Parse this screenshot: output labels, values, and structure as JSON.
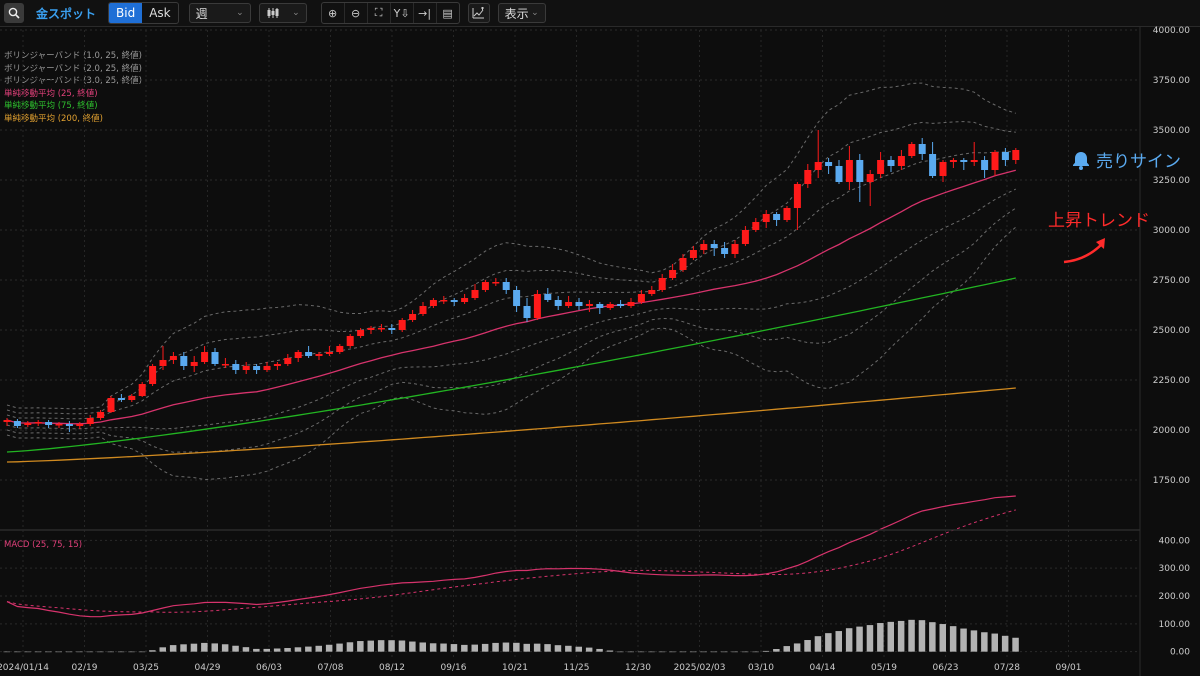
{
  "toolbar": {
    "symbol": "金スポット",
    "bid_label": "Bid",
    "ask_label": "Ask",
    "period": "週",
    "display_label": "表示"
  },
  "legend": [
    {
      "text": "ボリンジャーバンド (1.0, 25, 終値)",
      "color": "#9a9a9a"
    },
    {
      "text": "ボリンジャーバンド (2.0, 25, 終値)",
      "color": "#9a9a9a"
    },
    {
      "text": "ボリンジャーバンド (3.0, 25, 終値)",
      "color": "#9a9a9a"
    },
    {
      "text": "単純移動平均 (25, 終値)",
      "color": "#e0407a"
    },
    {
      "text": "単純移動平均 (75, 終値)",
      "color": "#2ec02e"
    },
    {
      "text": "単純移動平均 (200, 終値)",
      "color": "#e0a030"
    }
  ],
  "macd_label": "MACD (25, 75, 15)",
  "annotations": {
    "sell_sign": "売りサイン",
    "uptrend": "上昇トレンド"
  },
  "colors": {
    "up": "#ff1a1a",
    "down": "#5aaaf0",
    "ma25": "#d6336c",
    "ma75": "#22b422",
    "ma200": "#d08a20",
    "bb": "#6a6a6a",
    "hist": "#b3b3b3"
  },
  "chart_data": {
    "type": "candlestick",
    "price_axis": {
      "min": 1500,
      "max": 4000,
      "ticks": [
        "4000.00",
        "3750.00",
        "3500.00",
        "3250.00",
        "3000.00",
        "2750.00",
        "2500.00",
        "2250.00",
        "2000.00",
        "1750.00"
      ]
    },
    "macd_axis": {
      "min": -30,
      "max": 430,
      "ticks": [
        "400.00",
        "300.00",
        "200.00",
        "100.00",
        "0.00"
      ]
    },
    "date_labels": [
      "2024/01/14",
      "02/19",
      "03/25",
      "04/29",
      "06/03",
      "07/08",
      "08/12",
      "09/16",
      "10/21",
      "11/25",
      "12/30",
      "2025/02/03",
      "03/10",
      "04/14",
      "05/19",
      "06/23",
      "07/28",
      "09/01"
    ],
    "candles": [
      [
        2040,
        2050,
        2020,
        2060
      ],
      [
        2045,
        2020,
        2010,
        2055
      ],
      [
        2025,
        2035,
        2015,
        2045
      ],
      [
        2035,
        2040,
        2020,
        2050
      ],
      [
        2040,
        2025,
        2010,
        2050
      ],
      [
        2025,
        2030,
        2010,
        2040
      ],
      [
        2030,
        2020,
        1990,
        2045
      ],
      [
        2020,
        2030,
        2005,
        2040
      ],
      [
        2030,
        2060,
        2020,
        2075
      ],
      [
        2060,
        2090,
        2050,
        2100
      ],
      [
        2090,
        2160,
        2085,
        2170
      ],
      [
        2160,
        2150,
        2140,
        2180
      ],
      [
        2150,
        2170,
        2140,
        2180
      ],
      [
        2170,
        2230,
        2165,
        2240
      ],
      [
        2230,
        2320,
        2220,
        2330
      ],
      [
        2320,
        2350,
        2300,
        2420
      ],
      [
        2350,
        2370,
        2330,
        2390
      ],
      [
        2370,
        2320,
        2300,
        2390
      ],
      [
        2320,
        2340,
        2290,
        2370
      ],
      [
        2340,
        2390,
        2330,
        2420
      ],
      [
        2390,
        2330,
        2320,
        2410
      ],
      [
        2330,
        2330,
        2310,
        2360
      ],
      [
        2330,
        2300,
        2280,
        2350
      ],
      [
        2300,
        2320,
        2280,
        2340
      ],
      [
        2320,
        2300,
        2280,
        2330
      ],
      [
        2300,
        2320,
        2290,
        2340
      ],
      [
        2320,
        2330,
        2300,
        2340
      ],
      [
        2330,
        2360,
        2320,
        2380
      ],
      [
        2360,
        2390,
        2340,
        2400
      ],
      [
        2390,
        2370,
        2360,
        2420
      ],
      [
        2370,
        2380,
        2350,
        2390
      ],
      [
        2380,
        2390,
        2370,
        2420
      ],
      [
        2390,
        2420,
        2380,
        2430
      ],
      [
        2420,
        2470,
        2410,
        2480
      ],
      [
        2470,
        2500,
        2460,
        2510
      ],
      [
        2500,
        2510,
        2480,
        2520
      ],
      [
        2510,
        2510,
        2490,
        2530
      ],
      [
        2510,
        2500,
        2480,
        2530
      ],
      [
        2500,
        2550,
        2490,
        2560
      ],
      [
        2550,
        2580,
        2540,
        2600
      ],
      [
        2580,
        2620,
        2570,
        2640
      ],
      [
        2620,
        2650,
        2610,
        2660
      ],
      [
        2650,
        2650,
        2630,
        2670
      ],
      [
        2650,
        2640,
        2620,
        2660
      ],
      [
        2640,
        2660,
        2630,
        2680
      ],
      [
        2660,
        2700,
        2650,
        2730
      ],
      [
        2700,
        2740,
        2690,
        2750
      ],
      [
        2740,
        2740,
        2720,
        2760
      ],
      [
        2740,
        2700,
        2680,
        2760
      ],
      [
        2700,
        2620,
        2590,
        2720
      ],
      [
        2620,
        2560,
        2540,
        2660
      ],
      [
        2560,
        2680,
        2550,
        2700
      ],
      [
        2680,
        2650,
        2640,
        2710
      ],
      [
        2650,
        2620,
        2600,
        2670
      ],
      [
        2620,
        2640,
        2610,
        2670
      ],
      [
        2640,
        2620,
        2600,
        2660
      ],
      [
        2620,
        2630,
        2590,
        2650
      ],
      [
        2630,
        2610,
        2580,
        2640
      ],
      [
        2610,
        2630,
        2600,
        2640
      ],
      [
        2630,
        2620,
        2610,
        2650
      ],
      [
        2620,
        2640,
        2610,
        2660
      ],
      [
        2640,
        2680,
        2630,
        2700
      ],
      [
        2680,
        2700,
        2670,
        2720
      ],
      [
        2700,
        2760,
        2690,
        2780
      ],
      [
        2760,
        2800,
        2750,
        2830
      ],
      [
        2800,
        2860,
        2790,
        2880
      ],
      [
        2860,
        2900,
        2850,
        2920
      ],
      [
        2900,
        2930,
        2880,
        2950
      ],
      [
        2930,
        2910,
        2870,
        2950
      ],
      [
        2910,
        2880,
        2860,
        2940
      ],
      [
        2880,
        2930,
        2860,
        2950
      ],
      [
        2930,
        3000,
        2920,
        3020
      ],
      [
        3000,
        3040,
        2990,
        3060
      ],
      [
        3040,
        3080,
        3010,
        3100
      ],
      [
        3080,
        3050,
        3020,
        3090
      ],
      [
        3050,
        3110,
        3040,
        3120
      ],
      [
        3110,
        3230,
        3000,
        3240
      ],
      [
        3230,
        3300,
        3210,
        3330
      ],
      [
        3300,
        3340,
        3260,
        3500
      ],
      [
        3340,
        3320,
        3280,
        3360
      ],
      [
        3320,
        3240,
        3230,
        3350
      ],
      [
        3240,
        3350,
        3200,
        3420
      ],
      [
        3350,
        3240,
        3140,
        3380
      ],
      [
        3240,
        3280,
        3120,
        3300
      ],
      [
        3280,
        3350,
        3260,
        3390
      ],
      [
        3350,
        3320,
        3290,
        3370
      ],
      [
        3320,
        3370,
        3300,
        3400
      ],
      [
        3370,
        3430,
        3360,
        3440
      ],
      [
        3430,
        3380,
        3350,
        3460
      ],
      [
        3380,
        3270,
        3260,
        3440
      ],
      [
        3270,
        3340,
        3240,
        3350
      ],
      [
        3340,
        3350,
        3310,
        3360
      ],
      [
        3350,
        3340,
        3300,
        3360
      ],
      [
        3340,
        3350,
        3320,
        3440
      ],
      [
        3350,
        3300,
        3260,
        3370
      ],
      [
        3300,
        3390,
        3270,
        3400
      ],
      [
        3390,
        3350,
        3320,
        3410
      ],
      [
        3350,
        3400,
        3330,
        3410
      ]
    ],
    "sma25_endpoints": [
      [
        0,
        1970
      ],
      [
        97,
        3230
      ]
    ],
    "sma75_endpoints": [
      [
        0,
        1890
      ],
      [
        97,
        2760
      ]
    ],
    "sma200_endpoints": [
      [
        0,
        1840
      ],
      [
        97,
        2210
      ]
    ]
  }
}
